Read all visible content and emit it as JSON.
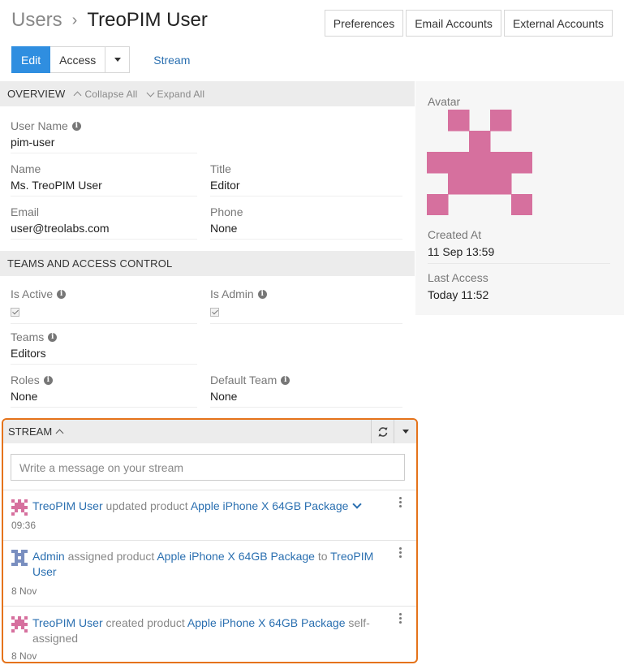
{
  "breadcrumb": {
    "parent": "Users",
    "separator": "›",
    "current": "TreoPIM User"
  },
  "top_buttons": [
    "Preferences",
    "Email Accounts",
    "External Accounts"
  ],
  "actions": {
    "edit": "Edit",
    "access": "Access",
    "stream": "Stream"
  },
  "overview": {
    "heading": "OVERVIEW",
    "collapse_all": "Collapse All",
    "expand_all": "Expand All",
    "user_name": {
      "label": "User Name",
      "value": "pim-user"
    },
    "name": {
      "label": "Name",
      "value": "Ms. TreoPIM User"
    },
    "title": {
      "label": "Title",
      "value": "Editor"
    },
    "email": {
      "label": "Email",
      "value": "user@treolabs.com"
    },
    "phone": {
      "label": "Phone",
      "value": "None"
    }
  },
  "teams_access": {
    "heading": "TEAMS AND ACCESS CONTROL",
    "is_active": {
      "label": "Is Active",
      "checked": true
    },
    "is_admin": {
      "label": "Is Admin",
      "checked": true
    },
    "teams": {
      "label": "Teams",
      "value": "Editors"
    },
    "roles": {
      "label": "Roles",
      "value": "None"
    },
    "default_team": {
      "label": "Default Team",
      "value": "None"
    }
  },
  "side": {
    "avatar_label": "Avatar",
    "avatar_color": "#d6709e",
    "created_at": {
      "label": "Created At",
      "value": "11 Sep 13:59"
    },
    "last_access": {
      "label": "Last Access",
      "value": "Today 11:52"
    }
  },
  "stream": {
    "heading": "STREAM",
    "placeholder": "Write a message on your stream",
    "entries": [
      {
        "user": "TreoPIM User",
        "verb": "updated product",
        "target": "Apple iPhone X 64GB Package",
        "time": "09:36",
        "avatar_color": "#d6709e"
      },
      {
        "user": "Admin",
        "verb": "assigned product",
        "target": "Apple iPhone X 64GB Package",
        "to": "to",
        "to_user": "TreoPIM User",
        "time": "8 Nov",
        "avatar_color": "#7a8fc0"
      },
      {
        "user": "TreoPIM User",
        "verb": "created product",
        "target": "Apple iPhone X 64GB Package",
        "suffix": "self-assigned",
        "time": "8 Nov",
        "avatar_color": "#d6709e"
      }
    ]
  }
}
